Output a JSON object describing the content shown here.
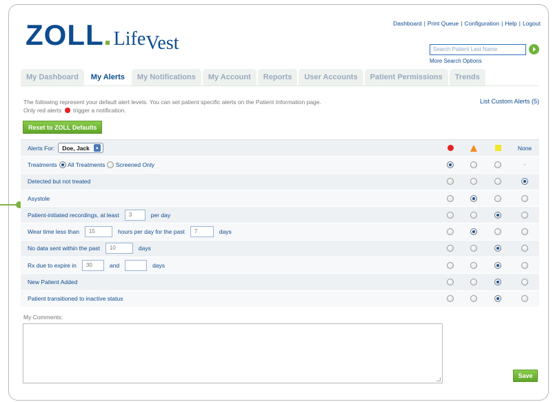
{
  "logo": {
    "brand": "ZOLL",
    "product_life": "Life",
    "product_vest": "Vest"
  },
  "top_links": [
    "Dashboard",
    "Print Queue",
    "Configuration",
    "Help",
    "Logout"
  ],
  "search": {
    "placeholder": "Search Patient Last Name",
    "more_options": "More Search Options"
  },
  "tabs": [
    {
      "label": "My Dashboard",
      "active": false
    },
    {
      "label": "My Alerts",
      "active": true
    },
    {
      "label": "My Notifications",
      "active": false
    },
    {
      "label": "My Account",
      "active": false
    },
    {
      "label": "Reports",
      "active": false
    },
    {
      "label": "User Accounts",
      "active": false
    },
    {
      "label": "Patient Permissions",
      "active": false
    },
    {
      "label": "Trends",
      "active": false
    }
  ],
  "intro": {
    "line1": "The following represent your default alert levels. You can set patient specific alerts on the Patient Information page.",
    "line2a": "Only red alerts",
    "line2b": "trigger a notification."
  },
  "custom_alerts_link": "List Custom Alerts (5)",
  "reset_button": "Reset to ZOLL Defaults",
  "header_row": {
    "alerts_for_label": "Alerts For:",
    "selected_patient": "Doe, Jack",
    "col_none": "None"
  },
  "treatments_row": {
    "label": "Treatments",
    "opt_all": "All Treatments",
    "opt_screened": "Screened Only",
    "none_value": "-"
  },
  "rows": {
    "detected": {
      "label": "Detected but not treated"
    },
    "asystole": {
      "label": "Asystole"
    },
    "recordings": {
      "pre": "Patient-initiated recordings, at least",
      "value": "3",
      "post": "per day"
    },
    "weartime": {
      "pre": "Wear time less than",
      "value1": "15",
      "mid": "hours per day for the past",
      "value2": "7",
      "post": "days"
    },
    "nodata": {
      "pre": "No data sent within the past",
      "value": "10",
      "post": "days"
    },
    "rx": {
      "pre": "Rx due to expire in",
      "value1": "30",
      "mid": "and",
      "value2": "",
      "post": "days"
    },
    "newpatient": {
      "label": "New Patient Added"
    },
    "inactive": {
      "label": "Patient transitioned to inactive status"
    }
  },
  "selections": {
    "treatments": "red",
    "detected": "none",
    "asystole": "orange",
    "recordings": "yellow",
    "weartime": "orange",
    "nodata": "yellow",
    "rx": "yellow",
    "newpatient": "yellow",
    "inactive": "yellow"
  },
  "comments_label": "My Comments:",
  "save_button": "Save",
  "colors": {
    "brand_blue": "#0d4c8f",
    "accent_green": "#6fb33b",
    "alert_red": "#e52222",
    "alert_orange": "#f08a1c",
    "alert_yellow": "#f3e52a"
  }
}
